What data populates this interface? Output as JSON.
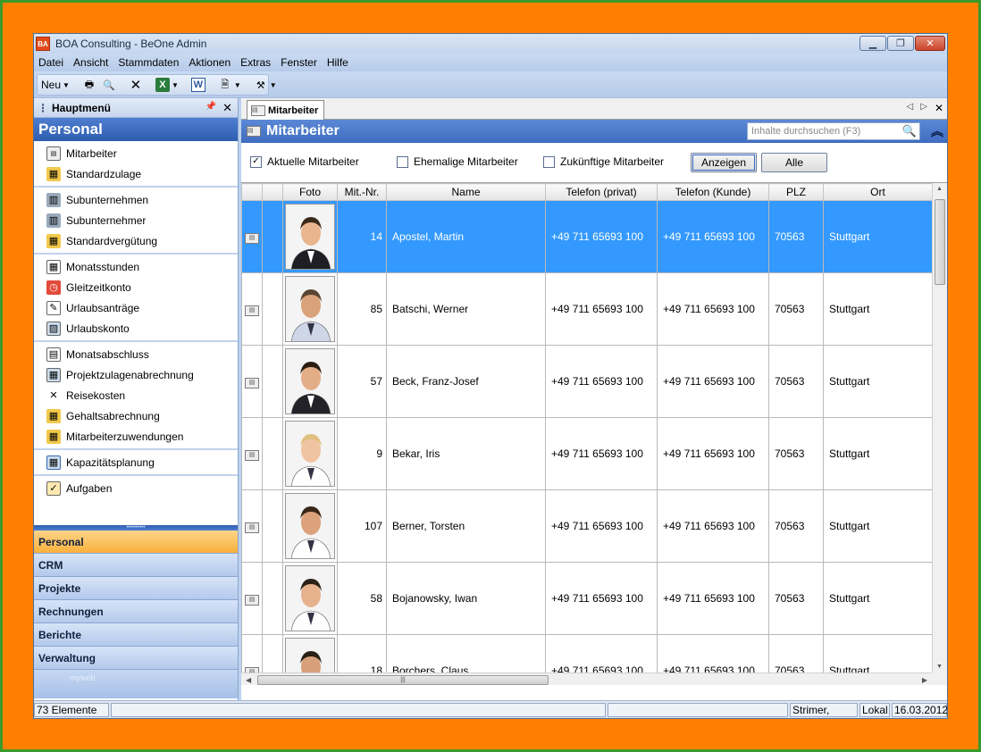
{
  "window": {
    "title": "BOA Consulting - BeOne Admin",
    "app_icon": "BA"
  },
  "menubar": [
    "Datei",
    "Ansicht",
    "Stammdaten",
    "Aktionen",
    "Extras",
    "Fenster",
    "Hilfe"
  ],
  "toolbar": {
    "new_label": "Neu"
  },
  "left_panel": {
    "header": "Hauptmenü",
    "section_title": "Personal",
    "groups": [
      [
        "Mitarbeiter",
        "Standardzulage"
      ],
      [
        "Subunternehmen",
        "Subunternehmer",
        "Standardvergütung"
      ],
      [
        "Monatsstunden",
        "Gleitzeitkonto",
        "Urlaubsanträge",
        "Urlaubskonto"
      ],
      [
        "Monatsabschluss",
        "Projektzulagenabrechnung",
        "Reisekosten",
        "Gehaltsabrechnung",
        "Mitarbeiterzuwendungen"
      ],
      [
        "Kapazitätsplanung"
      ],
      [
        "Aufgaben"
      ]
    ],
    "nav_buttons": [
      "Personal",
      "CRM",
      "Projekte",
      "Rechnungen",
      "Berichte",
      "Verwaltung"
    ],
    "active_nav": "Personal",
    "footer_text": "myweb"
  },
  "tab": {
    "label": "Mitarbeiter"
  },
  "main": {
    "title": "Mitarbeiter",
    "search_placeholder": "Inhalte durchsuchen (F3)",
    "filters": {
      "current_label": "Aktuelle Mitarbeiter",
      "current_checked": true,
      "former_label": "Ehemalige Mitarbeiter",
      "former_checked": false,
      "future_label": "Zukünftige Mitarbeiter",
      "future_checked": false,
      "show_button": "Anzeigen",
      "all_button": "Alle"
    },
    "columns": [
      "Foto",
      "Mit.-Nr.",
      "Name",
      "Telefon (privat)",
      "Telefon (Kunde)",
      "PLZ",
      "Ort"
    ],
    "rows": [
      {
        "nr": "14",
        "name": "Apostel, Martin",
        "tel_private": "+49 711 65693 100",
        "tel_customer": "+49 711 65693 100",
        "plz": "70563",
        "ort": "Stuttgart",
        "selected": true
      },
      {
        "nr": "85",
        "name": "Batschi, Werner",
        "tel_private": "+49 711 65693 100",
        "tel_customer": "+49 711 65693 100",
        "plz": "70563",
        "ort": "Stuttgart",
        "selected": false
      },
      {
        "nr": "57",
        "name": "Beck, Franz-Josef",
        "tel_private": "+49 711 65693 100",
        "tel_customer": "+49 711 65693 100",
        "plz": "70563",
        "ort": "Stuttgart",
        "selected": false
      },
      {
        "nr": "9",
        "name": "Bekar, Iris",
        "tel_private": "+49 711 65693 100",
        "tel_customer": "+49 711 65693 100",
        "plz": "70563",
        "ort": "Stuttgart",
        "selected": false
      },
      {
        "nr": "107",
        "name": "Berner, Torsten",
        "tel_private": "+49 711 65693 100",
        "tel_customer": "+49 711 65693 100",
        "plz": "70563",
        "ort": "Stuttgart",
        "selected": false
      },
      {
        "nr": "58",
        "name": "Bojanowsky, Iwan",
        "tel_private": "+49 711 65693 100",
        "tel_customer": "+49 711 65693 100",
        "plz": "70563",
        "ort": "Stuttgart",
        "selected": false
      },
      {
        "nr": "18",
        "name": "Borchers, Claus",
        "tel_private": "+49 711 65693 100",
        "tel_customer": "+49 711 65693 100",
        "plz": "70563",
        "ort": "Stuttgart",
        "selected": false
      }
    ]
  },
  "statusbar": {
    "count": "73 Elemente",
    "user": "Strimer, David",
    "mode": "Lokal",
    "date": "16.03.2012"
  },
  "colors": {
    "background": "#ff7f00",
    "frame": "#3a9a2a",
    "selection": "#3399ff",
    "header_blue": "#3f6cbf",
    "active_nav": "#f9b13c"
  }
}
